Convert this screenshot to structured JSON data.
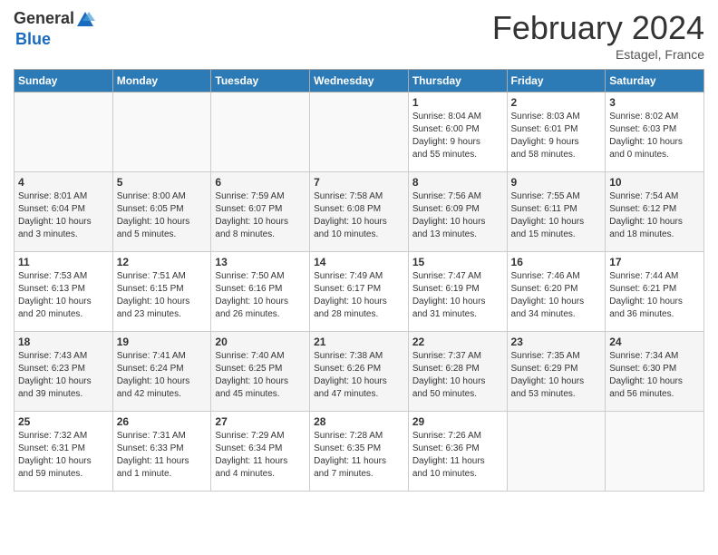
{
  "header": {
    "logo": {
      "general": "General",
      "blue": "Blue"
    },
    "month": "February 2024",
    "location": "Estagel, France"
  },
  "days_of_week": [
    "Sunday",
    "Monday",
    "Tuesday",
    "Wednesday",
    "Thursday",
    "Friday",
    "Saturday"
  ],
  "weeks": [
    [
      {
        "day": "",
        "info": ""
      },
      {
        "day": "",
        "info": ""
      },
      {
        "day": "",
        "info": ""
      },
      {
        "day": "",
        "info": ""
      },
      {
        "day": "1",
        "info": "Sunrise: 8:04 AM\nSunset: 6:00 PM\nDaylight: 9 hours\nand 55 minutes."
      },
      {
        "day": "2",
        "info": "Sunrise: 8:03 AM\nSunset: 6:01 PM\nDaylight: 9 hours\nand 58 minutes."
      },
      {
        "day": "3",
        "info": "Sunrise: 8:02 AM\nSunset: 6:03 PM\nDaylight: 10 hours\nand 0 minutes."
      }
    ],
    [
      {
        "day": "4",
        "info": "Sunrise: 8:01 AM\nSunset: 6:04 PM\nDaylight: 10 hours\nand 3 minutes."
      },
      {
        "day": "5",
        "info": "Sunrise: 8:00 AM\nSunset: 6:05 PM\nDaylight: 10 hours\nand 5 minutes."
      },
      {
        "day": "6",
        "info": "Sunrise: 7:59 AM\nSunset: 6:07 PM\nDaylight: 10 hours\nand 8 minutes."
      },
      {
        "day": "7",
        "info": "Sunrise: 7:58 AM\nSunset: 6:08 PM\nDaylight: 10 hours\nand 10 minutes."
      },
      {
        "day": "8",
        "info": "Sunrise: 7:56 AM\nSunset: 6:09 PM\nDaylight: 10 hours\nand 13 minutes."
      },
      {
        "day": "9",
        "info": "Sunrise: 7:55 AM\nSunset: 6:11 PM\nDaylight: 10 hours\nand 15 minutes."
      },
      {
        "day": "10",
        "info": "Sunrise: 7:54 AM\nSunset: 6:12 PM\nDaylight: 10 hours\nand 18 minutes."
      }
    ],
    [
      {
        "day": "11",
        "info": "Sunrise: 7:53 AM\nSunset: 6:13 PM\nDaylight: 10 hours\nand 20 minutes."
      },
      {
        "day": "12",
        "info": "Sunrise: 7:51 AM\nSunset: 6:15 PM\nDaylight: 10 hours\nand 23 minutes."
      },
      {
        "day": "13",
        "info": "Sunrise: 7:50 AM\nSunset: 6:16 PM\nDaylight: 10 hours\nand 26 minutes."
      },
      {
        "day": "14",
        "info": "Sunrise: 7:49 AM\nSunset: 6:17 PM\nDaylight: 10 hours\nand 28 minutes."
      },
      {
        "day": "15",
        "info": "Sunrise: 7:47 AM\nSunset: 6:19 PM\nDaylight: 10 hours\nand 31 minutes."
      },
      {
        "day": "16",
        "info": "Sunrise: 7:46 AM\nSunset: 6:20 PM\nDaylight: 10 hours\nand 34 minutes."
      },
      {
        "day": "17",
        "info": "Sunrise: 7:44 AM\nSunset: 6:21 PM\nDaylight: 10 hours\nand 36 minutes."
      }
    ],
    [
      {
        "day": "18",
        "info": "Sunrise: 7:43 AM\nSunset: 6:23 PM\nDaylight: 10 hours\nand 39 minutes."
      },
      {
        "day": "19",
        "info": "Sunrise: 7:41 AM\nSunset: 6:24 PM\nDaylight: 10 hours\nand 42 minutes."
      },
      {
        "day": "20",
        "info": "Sunrise: 7:40 AM\nSunset: 6:25 PM\nDaylight: 10 hours\nand 45 minutes."
      },
      {
        "day": "21",
        "info": "Sunrise: 7:38 AM\nSunset: 6:26 PM\nDaylight: 10 hours\nand 47 minutes."
      },
      {
        "day": "22",
        "info": "Sunrise: 7:37 AM\nSunset: 6:28 PM\nDaylight: 10 hours\nand 50 minutes."
      },
      {
        "day": "23",
        "info": "Sunrise: 7:35 AM\nSunset: 6:29 PM\nDaylight: 10 hours\nand 53 minutes."
      },
      {
        "day": "24",
        "info": "Sunrise: 7:34 AM\nSunset: 6:30 PM\nDaylight: 10 hours\nand 56 minutes."
      }
    ],
    [
      {
        "day": "25",
        "info": "Sunrise: 7:32 AM\nSunset: 6:31 PM\nDaylight: 10 hours\nand 59 minutes."
      },
      {
        "day": "26",
        "info": "Sunrise: 7:31 AM\nSunset: 6:33 PM\nDaylight: 11 hours\nand 1 minute."
      },
      {
        "day": "27",
        "info": "Sunrise: 7:29 AM\nSunset: 6:34 PM\nDaylight: 11 hours\nand 4 minutes."
      },
      {
        "day": "28",
        "info": "Sunrise: 7:28 AM\nSunset: 6:35 PM\nDaylight: 11 hours\nand 7 minutes."
      },
      {
        "day": "29",
        "info": "Sunrise: 7:26 AM\nSunset: 6:36 PM\nDaylight: 11 hours\nand 10 minutes."
      },
      {
        "day": "",
        "info": ""
      },
      {
        "day": "",
        "info": ""
      }
    ]
  ]
}
